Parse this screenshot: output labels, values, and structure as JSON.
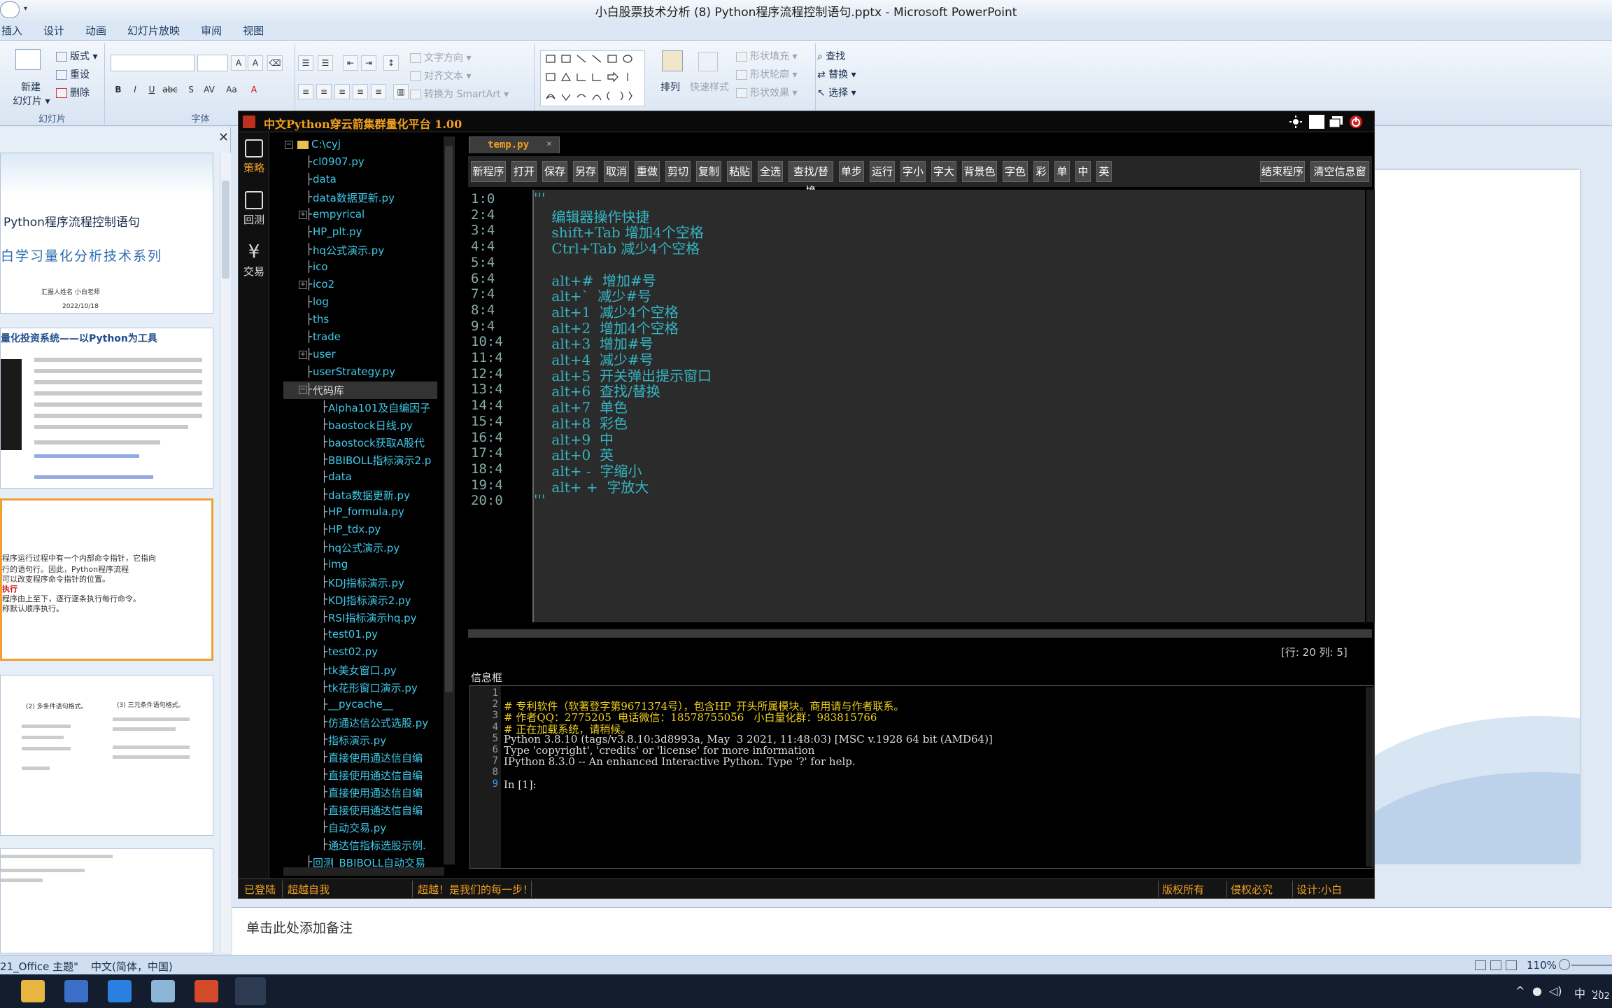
{
  "ppt": {
    "window_title": "小白股票技术分析 (8) Python程序流程控制语句.pptx - Microsoft PowerPoint",
    "tabs": [
      "插入",
      "设计",
      "动画",
      "幻灯片放映",
      "审阅",
      "视图"
    ],
    "ribbon": {
      "new_slide": "新建\n幻灯片",
      "new_slide_line1": "新建",
      "new_slide_line2": "幻灯片 ▾",
      "layout": "版式",
      "reset": "重设",
      "delete": "删除",
      "slides_group": "幻灯片",
      "font_group": "字体",
      "text_direction": "文字方向",
      "align_text": "对齐文本",
      "convert_smartart": "转换为 SmartArt",
      "arrange": "排列",
      "quick_styles": "快速样式",
      "shape_fill": "形状填充",
      "shape_outline": "形状轮廓",
      "shape_effects": "形状效果",
      "find": "查找",
      "replace": "替换",
      "select": "选择"
    },
    "thumb1": {
      "title": "Python程序流程控制语句",
      "subtitle": "白学习量化分析技术系列",
      "author": "汇报人姓名     小白老师",
      "date": "2022/10/18"
    },
    "thumb2": {
      "title": "量化投资系统——以Python为工具"
    },
    "thumb3": {
      "line1": "程序运行过程中有一个内部命令指针，它指向",
      "line2": "行的语句行。因此，Python程序流程",
      "line3": "可以改变程序命令指针的位置。",
      "line4": "执行",
      "line5": "程序由上至下，逐行逐条执行每行命令。",
      "line6": "称默认顺序执行。"
    },
    "thumb4": {
      "a": "(2) 多条件语句格式。",
      "b": "(3) 三元条件语句格式。"
    },
    "notes_placeholder": "单击此处添加备注",
    "status": {
      "theme": "21_Office 主题\"",
      "language": "中文(简体，中国)",
      "zoom": "110%"
    },
    "tray": {
      "ime": "中",
      "year": "202"
    }
  },
  "app": {
    "title": "中文Python穿云箭集群量化平台 1.00",
    "nav": [
      {
        "label": "策略",
        "icon": "strategy-icon"
      },
      {
        "label": "回测",
        "icon": "backtest-icon"
      },
      {
        "label": "交易",
        "icon": "trade-icon"
      }
    ],
    "tree": [
      {
        "label": "C:\\cyj",
        "toggle": "⊟",
        "level": 0,
        "folder": true
      },
      {
        "label": "cl0907.py",
        "level": 1
      },
      {
        "label": "data",
        "level": 1
      },
      {
        "label": "data数据更新.py",
        "level": 1
      },
      {
        "label": "empyrical",
        "toggle": "⊞",
        "level": 1
      },
      {
        "label": "HP_plt.py",
        "level": 1
      },
      {
        "label": "hq公式演示.py",
        "level": 1
      },
      {
        "label": "ico",
        "level": 1
      },
      {
        "label": "ico2",
        "toggle": "⊞",
        "level": 1
      },
      {
        "label": "log",
        "level": 1
      },
      {
        "label": "ths",
        "level": 1
      },
      {
        "label": "trade",
        "level": 1
      },
      {
        "label": "user",
        "toggle": "⊞",
        "level": 1
      },
      {
        "label": "userStrategy.py",
        "level": 1
      },
      {
        "label": "代码库",
        "toggle": "⊟",
        "level": 1,
        "highlight": true
      },
      {
        "label": "Alpha101及自编因子",
        "level": 2
      },
      {
        "label": "baostock日线.py",
        "level": 2
      },
      {
        "label": "baostock获取A股代",
        "level": 2
      },
      {
        "label": "BBIBOLL指标演示2.p",
        "level": 2
      },
      {
        "label": "data",
        "level": 2
      },
      {
        "label": "data数据更新.py",
        "level": 2
      },
      {
        "label": "HP_formula.py",
        "level": 2
      },
      {
        "label": "HP_tdx.py",
        "level": 2
      },
      {
        "label": "hq公式演示.py",
        "level": 2
      },
      {
        "label": "img",
        "level": 2
      },
      {
        "label": "KDJ指标演示.py",
        "level": 2
      },
      {
        "label": "KDJ指标演示2.py",
        "level": 2
      },
      {
        "label": "RSI指标演示hq.py",
        "level": 2
      },
      {
        "label": "test01.py",
        "level": 2
      },
      {
        "label": "test02.py",
        "level": 2
      },
      {
        "label": "tk美女窗口.py",
        "level": 2
      },
      {
        "label": "tk花形窗口演示.py",
        "level": 2
      },
      {
        "label": "__pycache__",
        "level": 2
      },
      {
        "label": "仿通达信公式选股.py",
        "level": 2
      },
      {
        "label": "指标演示.py",
        "level": 2
      },
      {
        "label": "直接使用通达信自编",
        "level": 2
      },
      {
        "label": "直接使用通达信自编",
        "level": 2
      },
      {
        "label": "直接使用通达信自编",
        "level": 2
      },
      {
        "label": "直接使用通达信自编",
        "level": 2
      },
      {
        "label": "自动交易.py",
        "level": 2
      },
      {
        "label": "通达信指标选股示例.",
        "level": 2
      },
      {
        "label": "回测_BBIBOLL自动交易",
        "level": 1
      }
    ],
    "editor_tab": "temp.py",
    "toolbar": [
      "新程序",
      "打开",
      "保存",
      "另存",
      "取消",
      "重做",
      "剪切",
      "复制",
      "粘贴",
      "全选",
      "查找/替换",
      "单步",
      "运行",
      "字小",
      "字大",
      "背景色",
      "字色",
      "彩",
      "单",
      "中",
      "英"
    ],
    "toolbar_right": [
      "结束程序",
      "清空信息窗"
    ],
    "gutter": [
      "1:0",
      "2:4",
      "3:4",
      "4:4",
      "5:4",
      "6:4",
      "7:4",
      "8:4",
      "9:4",
      "10:4",
      "11:4",
      "12:4",
      "13:4",
      "14:4",
      "15:4",
      "16:4",
      "17:4",
      "18:4",
      "19:4",
      "20:0"
    ],
    "code": [
      "'''",
      "    编辑器操作快捷",
      "    shift+Tab 增加4个空格",
      "    Ctrl+Tab 减少4个空格",
      "",
      "    alt+#  增加#号",
      "    alt+`  减少#号",
      "    alt+1  减少4个空格",
      "    alt+2  增加4个空格",
      "    alt+3  增加#号",
      "    alt+4  减少#号",
      "    alt+5  开关弹出提示窗口",
      "    alt+6  查找/替换",
      "    alt+7  单色",
      "    alt+8  彩色",
      "    alt+9  中",
      "    alt+0  英",
      "    alt+ -  字缩小",
      "    alt+ +  字放大",
      "'''"
    ],
    "cursor_pos": "[行: 20   列: 5]",
    "info_label": "信息框",
    "info_gutter": [
      "1",
      "2",
      "3",
      "4",
      "5",
      "6",
      "7",
      "8",
      "9"
    ],
    "info_lines": [
      "",
      "# 专利软件（软著登字第9671374号），包含HP_开头所属模块。商用请与作者联系。",
      "# 作者QQ：2775205  电话微信：18578755056   小白量化群：983815766",
      "# 正在加载系统，请稍候。",
      "Python 3.8.10 (tags/v3.8.10:3d8993a, May  3 2021, 11:48:03) [MSC v.1928 64 bit (AMD64)]",
      "Type 'copyright', 'credits' or 'license' for more information",
      "IPython 8.3.0 -- An enhanced Interactive Python. Type '?' for help.",
      "",
      "In [1]:"
    ],
    "status": {
      "logged_in": "已登陆",
      "slogan1": "超越自我",
      "slogan2": "超越！是我们的每一步！",
      "copyright": "版权所有",
      "infringe": "侵权必究",
      "design": "设计:小白"
    }
  }
}
